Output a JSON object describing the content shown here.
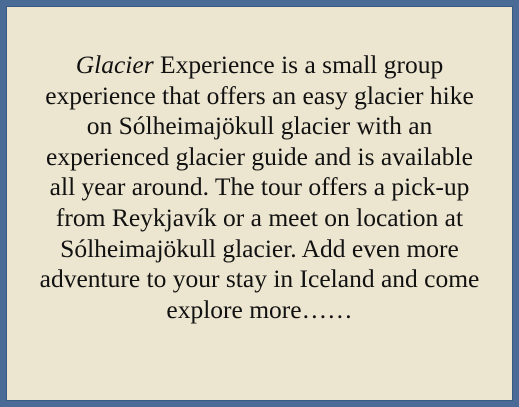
{
  "card": {
    "italic_word": "Glacier",
    "body_text": " Experience is a small group experience that offers an easy glacier hike on Sólheimajökull glacier with an experienced glacier guide and is available all year around. The tour offers a pick-up from Reykjavík or a meet on location at Sólheimajökull glacier. Add even more adventure to your stay in Iceland and come explore more……"
  },
  "colors": {
    "border": "#4a6b96",
    "background": "#ece5cf",
    "text": "#111111"
  }
}
